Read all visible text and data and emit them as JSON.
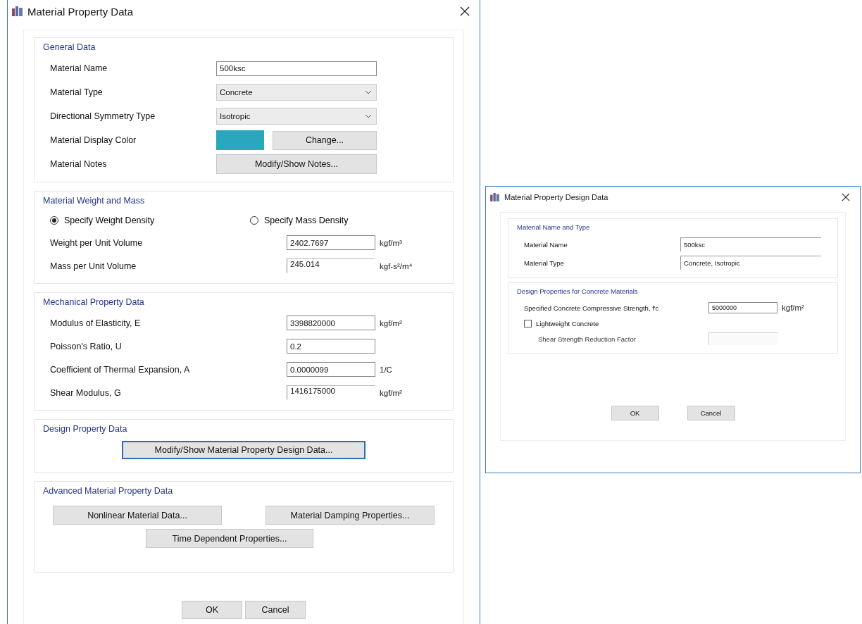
{
  "material_dialog": {
    "title": "Material Property Data",
    "general_data": {
      "heading": "General Data",
      "rows": [
        {
          "kind": "text",
          "label": "Material Name",
          "value": "500ksc"
        },
        {
          "kind": "dropdown",
          "label": "Material Type",
          "value": "Concrete"
        },
        {
          "kind": "dropdown",
          "label": "Directional Symmetry Type",
          "value": "Isotropic"
        },
        {
          "kind": "color",
          "label": "Material Display Color",
          "color": "#2aa6bd",
          "button": "Change..."
        },
        {
          "kind": "button",
          "label": "Material Notes",
          "button": "Modify/Show Notes..."
        }
      ]
    },
    "weight_and_mass": {
      "heading": "Material Weight and Mass",
      "options": [
        {
          "label": "Specify Weight Density",
          "selected": true
        },
        {
          "label": "Specify Mass Density",
          "selected": false
        }
      ],
      "rows": [
        {
          "label": "Weight per Unit Volume",
          "value": "2402.7697",
          "unit": "kgf/m³",
          "readonly": false
        },
        {
          "label": "Mass per Unit Volume",
          "value": "245.014",
          "unit": "kgf-s²/m⁴",
          "readonly": true
        }
      ]
    },
    "mechanical": {
      "heading": "Mechanical Property Data",
      "rows": [
        {
          "label": "Modulus of Elasticity,  E",
          "value": "3398820000",
          "unit": "kgf/m²",
          "readonly": false
        },
        {
          "label": "Poisson's Ratio,  U",
          "value": "0.2",
          "unit": "",
          "readonly": false
        },
        {
          "label": "Coefficient of Thermal Expansion,  A",
          "value": "0.0000099",
          "unit": "1/C",
          "readonly": false
        },
        {
          "label": "Shear Modulus,  G",
          "value": "1416175000",
          "unit": "kgf/m²",
          "readonly": true
        }
      ]
    },
    "design": {
      "heading": "Design Property Data",
      "button": "Modify/Show Material Property Design Data..."
    },
    "advanced": {
      "heading": "Advanced Material Property Data",
      "buttons": [
        "Nonlinear Material Data...",
        "Material Damping Properties...",
        "Time Dependent Properties..."
      ]
    },
    "buttons": [
      "OK",
      "Cancel"
    ]
  },
  "design_dialog": {
    "title": "Material Property Design Data",
    "name_and_type": {
      "heading": "Material Name and Type",
      "rows": [
        {
          "label": "Material Name",
          "value": "500ksc"
        },
        {
          "label": "Material Type",
          "value": "Concrete, Isotropic"
        }
      ]
    },
    "concrete": {
      "heading": "Design Properties for Concrete Materials",
      "strength": {
        "label": "Specified Concrete Compressive Strength, f'c",
        "value": "5000000",
        "unit": "kgf/m²"
      },
      "lightweight": {
        "label": "Lightweight Concrete",
        "checked": false
      },
      "shear_factor": {
        "label": "Shear Strength Reduction Factor",
        "disabled": true
      }
    },
    "buttons": [
      "OK",
      "Cancel"
    ]
  }
}
